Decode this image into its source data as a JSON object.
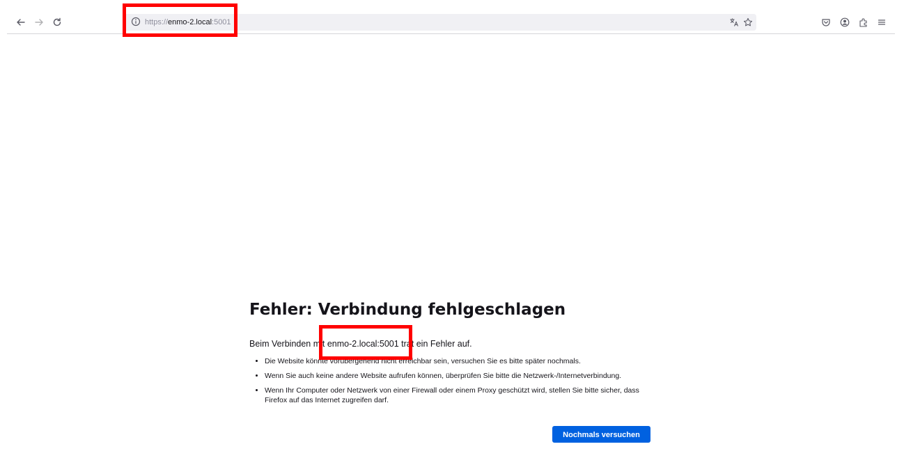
{
  "browser": {
    "back_icon": "back-arrow-icon",
    "forward_icon": "forward-arrow-icon",
    "reload_icon": "reload-icon",
    "url": {
      "scheme": "https://",
      "host": "enmo-2.local",
      "port": ":5001"
    },
    "right_icons": [
      "translate-icon",
      "bookmark-star-icon",
      "pocket-icon",
      "account-icon",
      "extensions-icon",
      "menu-icon"
    ]
  },
  "error_page": {
    "title": "Fehler: Verbindung fehlgeschlagen",
    "description": "Beim Verbinden mit enmo-2.local:5001 trat ein Fehler auf.",
    "bullets": [
      "Die Website könnte vorübergehend nicht erreichbar sein, versuchen Sie es bitte später nochmals.",
      "Wenn Sie auch keine andere Website aufrufen können, überprüfen Sie bitte die Netzwerk-/Internetverbindung.",
      "Wenn Ihr Computer oder Netzwerk von einer Firewall oder einem Proxy geschützt wird, stellen Sie bitte sicher, dass Firefox auf das Internet zugreifen darf."
    ],
    "retry_label": "Nochmals versuchen"
  },
  "colors": {
    "accent_button": "#0061e0",
    "highlight_box": "#ff0000"
  }
}
